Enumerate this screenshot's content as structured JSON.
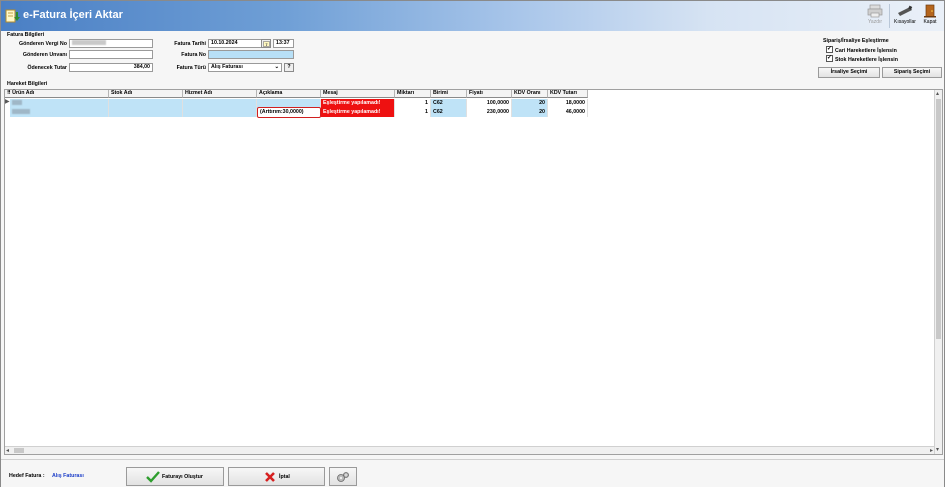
{
  "window": {
    "title": "e-Fatura İçeri Aktar"
  },
  "toolbar": {
    "print_label": "Yazdır",
    "shortcuts_label": "Kısayollar",
    "close_label": "Kapat"
  },
  "invoice_info": {
    "section_title": "Fatura Bilgileri",
    "sender_tax_no_label": "Gönderen Vergi No",
    "sender_title_label": "Gönderen Unvanı",
    "amount_due_label": "Ödenecek Tutar",
    "amount_due_value": "384,00",
    "invoice_date_label": "Fatura Tarihi",
    "invoice_date_value": "10.10.2024",
    "invoice_time_value": "13:37",
    "invoice_no_label": "Fatura No",
    "invoice_no_value": "",
    "invoice_type_label": "Fatura Türü",
    "invoice_type_value": "Alış Faturası",
    "help_button": "?"
  },
  "matching": {
    "section_title": "Sipariş/İrsaliye Eşleştirme",
    "cari_label": "Cari Hareketlere İşlensin",
    "cari_checked": true,
    "stok_label": "Stok Hareketlere İşlensin",
    "stok_checked": true,
    "irsaliye_button": "İrsaliye Seçimi",
    "siparis_button": "Sipariş Seçimi"
  },
  "movements": {
    "section_title": "Hareket Bilgileri",
    "columns": [
      "Ürün Adı",
      "Stok Adı",
      "Hizmet Adı",
      "Açıklama",
      "Mesaj",
      "Miktarı",
      "Birimi",
      "Fiyatı",
      "KDV Oranı",
      "KDV Tutarı"
    ],
    "rows": [
      {
        "urun": "",
        "stok": "",
        "hizmet": "",
        "aciklama": "",
        "mesaj": "Eşleştirme yapılamadı!",
        "miktar": "1",
        "birim": "C62",
        "fiyat": "100,0000",
        "kdv_orani": "20",
        "kdv_tutari": "18,0000"
      },
      {
        "urun": "",
        "stok": "",
        "hizmet": "",
        "aciklama": "(Arttırım:30,0000)",
        "mesaj": "Eşleştirme yapılamadı!",
        "miktar": "1",
        "birim": "C62",
        "fiyat": "230,0000",
        "kdv_orani": "20",
        "kdv_tutari": "46,0000"
      }
    ]
  },
  "footer": {
    "target_label": "Hedef Fatura :",
    "target_value": "Alış Faturası",
    "create_button": "Faturayı Oluştur",
    "cancel_button": "İptal"
  },
  "colors": {
    "selection": "#bfe3f7",
    "error": "#ee1111",
    "link_blue": "#1a3cc8"
  }
}
